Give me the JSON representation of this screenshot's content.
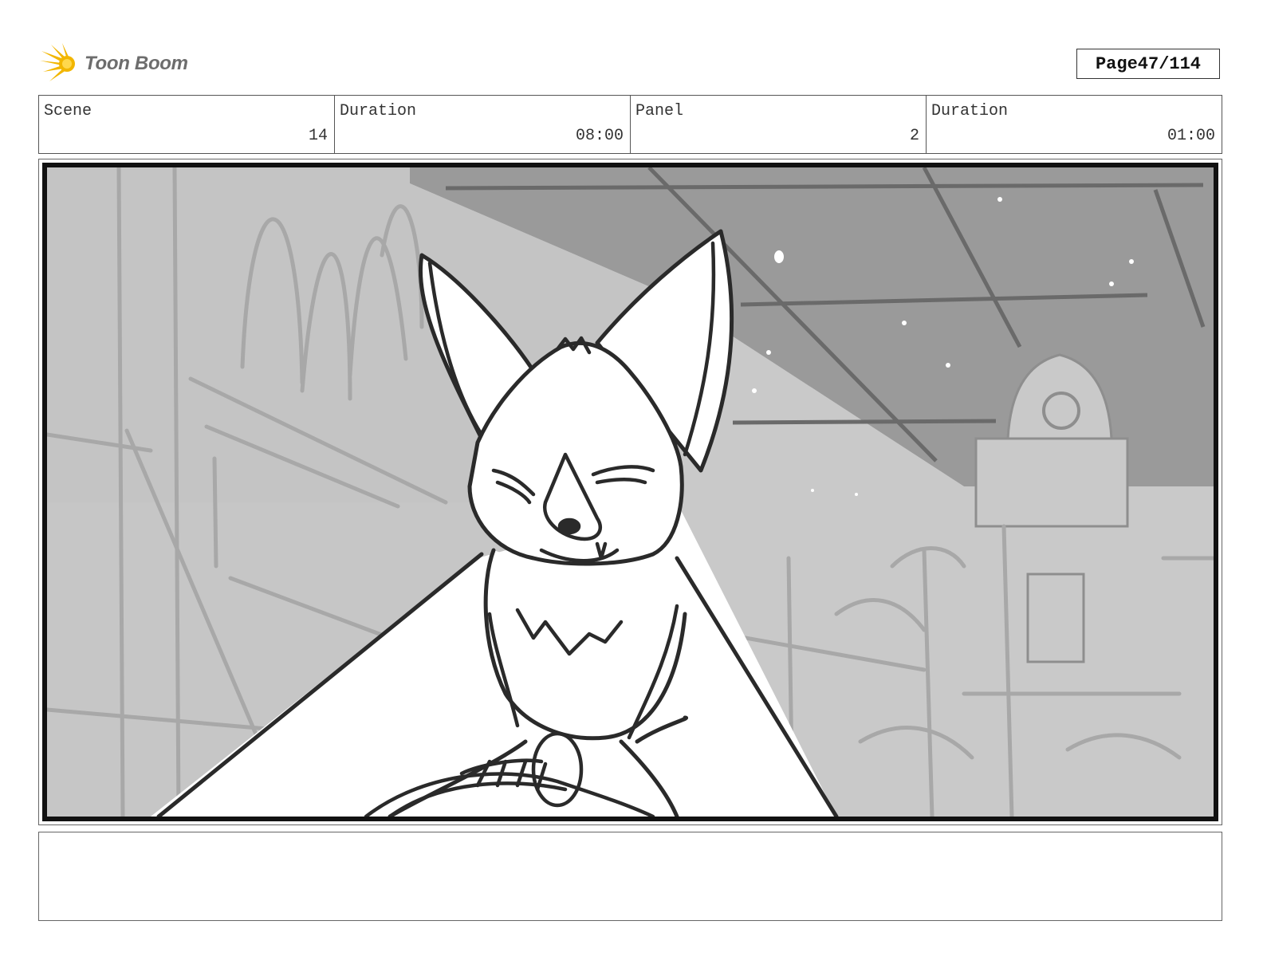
{
  "header": {
    "logo_text": "Toon Boom",
    "page_label": "Page",
    "page_number": "47/114"
  },
  "info": [
    {
      "label": "Scene",
      "value": "14"
    },
    {
      "label": "Duration",
      "value": "08:00"
    },
    {
      "label": "Panel",
      "value": "2"
    },
    {
      "label": "Duration",
      "value": "01:00"
    }
  ],
  "panel": {
    "image_subject": "storyboard-sketch-fox-character",
    "background_color": "#c6c6c6",
    "sky_color": "#9a9a9a",
    "line_color": "#2a2a2a"
  },
  "notes": {
    "text": ""
  },
  "colors": {
    "logo_accent": "#f2b600",
    "border": "#555555"
  }
}
